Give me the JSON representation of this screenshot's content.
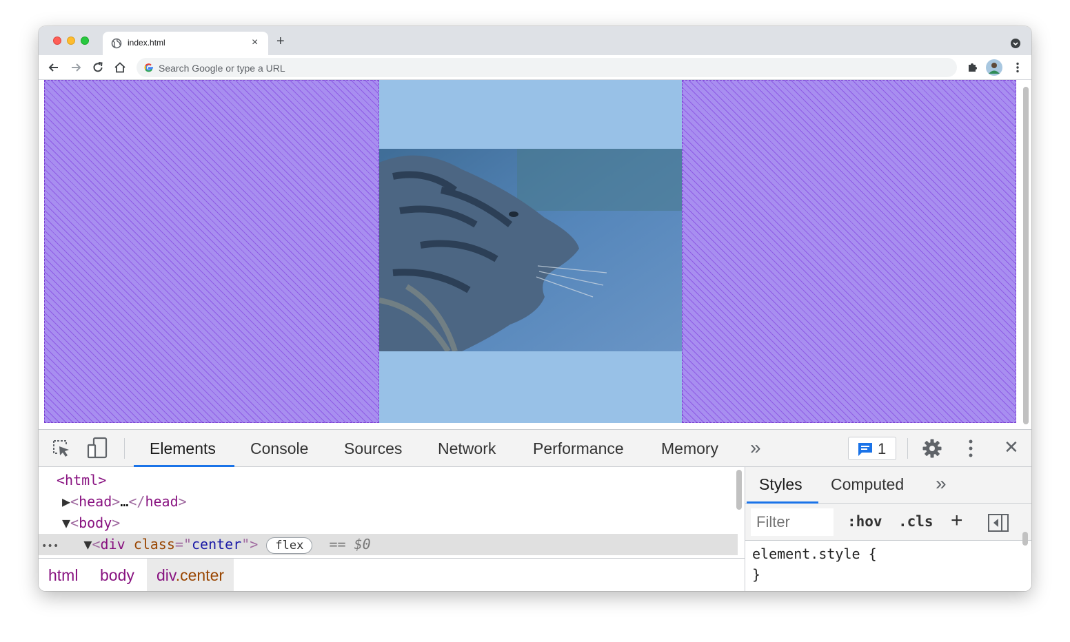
{
  "browser": {
    "tab": {
      "title": "index.html",
      "close_glyph": "×"
    },
    "new_tab_glyph": "+",
    "omnibox": {
      "placeholder": "Search Google or type a URL"
    }
  },
  "devtools": {
    "tabs": [
      {
        "label": "Elements",
        "active": true
      },
      {
        "label": "Console"
      },
      {
        "label": "Sources"
      },
      {
        "label": "Network"
      },
      {
        "label": "Performance"
      },
      {
        "label": "Memory"
      }
    ],
    "more_tabs_glyph": "»",
    "issues_count": "1",
    "close_glyph": "✕",
    "dom": {
      "html_open": "<html>",
      "head_tag": "head",
      "ellipsis": "…",
      "body_tag": "body",
      "div_tag": "div",
      "attr_name": "class",
      "attr_value": "center",
      "badge": "flex",
      "equals": "==",
      "dollar": "$0",
      "dots": "•••"
    },
    "breadcrumbs": {
      "html": "html",
      "body": "body",
      "div_tag": "div",
      "div_class": ".center"
    },
    "styles": {
      "tabs": [
        {
          "label": "Styles",
          "active": true
        },
        {
          "label": "Computed"
        }
      ],
      "more_glyph": "»",
      "filter_placeholder": "Filter",
      "hov": ":hov",
      "cls": ".cls",
      "plus": "+",
      "rule_selector": "element.style {",
      "rule_close": "}"
    }
  },
  "colors": {
    "hatch": "#a88ef0",
    "center_box": "#98c1e7",
    "accent": "#1a73e8",
    "tag": "#881280",
    "attr_name": "#994500",
    "attr_value": "#1a1aa6"
  }
}
